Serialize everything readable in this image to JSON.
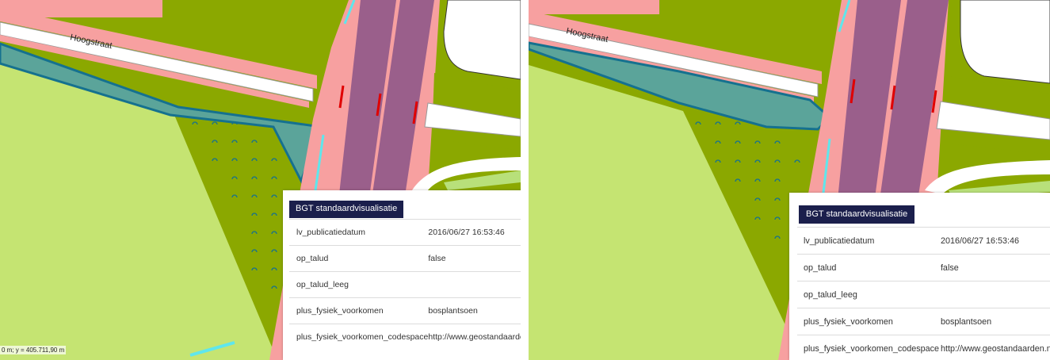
{
  "map": {
    "street_label": "Hoogstraat",
    "coordinate_readout": "0 m; y = 405.711,90 m",
    "colors": {
      "grass": "#c5e472",
      "dark_green": "#8ba800",
      "road_pink": "#f7a0a0",
      "road_purple": "#9a5f8b",
      "water": "#5ba49a",
      "outline": "#15718f",
      "cyan": "#5fe6ec",
      "red_marker": "#e00000",
      "white_road": "#ffffff"
    },
    "icons": {
      "shrub_symbol": "shrub-arc-icon"
    }
  },
  "info_panel": {
    "title": "BGT standaardvisualisatie",
    "rows": [
      {
        "key": "lv_publicatiedatum",
        "value": "2016/06/27 16:53:46"
      },
      {
        "key": "op_talud",
        "value": "false"
      },
      {
        "key": "op_talud_leeg",
        "value": ""
      },
      {
        "key": "plus_fysiek_voorkomen",
        "value": "bosplantsoen"
      },
      {
        "key": "plus_fysiek_voorkomen_codespace",
        "value": "http://www.geostandaarden.nl"
      }
    ]
  }
}
